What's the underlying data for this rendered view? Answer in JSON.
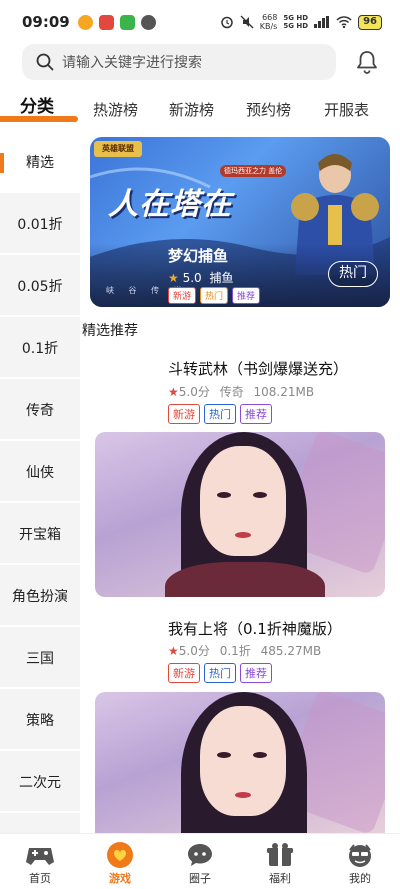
{
  "status_bar": {
    "time": "09:09",
    "net_speed_value": "668",
    "net_speed_unit": "KB/s",
    "signal": "5G HD",
    "signal2": "5G HD",
    "battery": "96"
  },
  "search": {
    "placeholder": "请输入关键字进行搜索"
  },
  "top_tabs": [
    {
      "label": "分类"
    },
    {
      "label": "热游榜"
    },
    {
      "label": "新游榜"
    },
    {
      "label": "预约榜"
    },
    {
      "label": "开服表"
    }
  ],
  "sidebar": {
    "items": [
      {
        "label": "精选"
      },
      {
        "label": "0.01折"
      },
      {
        "label": "0.05折"
      },
      {
        "label": "0.1折"
      },
      {
        "label": "传奇"
      },
      {
        "label": "仙侠"
      },
      {
        "label": "开宝箱"
      },
      {
        "label": "角色扮演"
      },
      {
        "label": "三国"
      },
      {
        "label": "策略"
      },
      {
        "label": "二次元"
      }
    ]
  },
  "banner": {
    "art_title": "人在塔在",
    "logo_text": "英雄联盟",
    "sub_text": "德玛西亚之力 盖伦",
    "side_text": "峡 谷 传 说",
    "game_name": "梦幻捕鱼",
    "rating": "5.0",
    "genre": "捕鱼",
    "tags": [
      "新游",
      "热门",
      "推荐"
    ],
    "button_label": "热门"
  },
  "section_title": "精选推荐",
  "games": [
    {
      "name": "斗转武林（书剑爆爆送充）",
      "rating": "5.0分",
      "genre": "传奇",
      "size": "108.21MB",
      "tags": [
        "新游",
        "热门",
        "推荐"
      ]
    },
    {
      "name": "我有上将（0.1折神魔版）",
      "rating": "5.0分",
      "genre": "0.1折",
      "size": "485.27MB",
      "tags": [
        "新游",
        "热门",
        "推荐"
      ]
    }
  ],
  "bottom_nav": [
    {
      "label": "首页"
    },
    {
      "label": "游戏"
    },
    {
      "label": "圈子"
    },
    {
      "label": "福利"
    },
    {
      "label": "我的"
    }
  ],
  "colors": {
    "accent": "#f07a1a",
    "tag_red": "#e2483d",
    "tag_blue": "#2a64d6",
    "tag_purple": "#8a4bd6"
  }
}
